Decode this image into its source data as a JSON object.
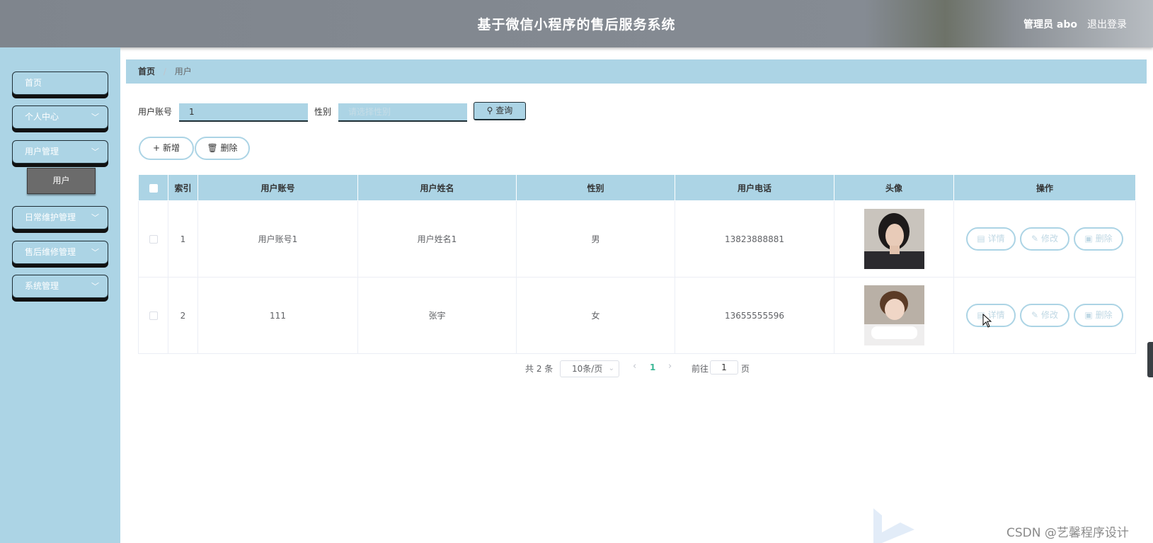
{
  "header": {
    "title": "基于微信小程序的售后服务系统",
    "user": "管理员 abo",
    "logout": "退出登录"
  },
  "sidebar": {
    "items": [
      {
        "label": "首页",
        "has_children": false
      },
      {
        "label": "个人中心",
        "has_children": true
      },
      {
        "label": "用户管理",
        "has_children": true
      },
      {
        "label": "日常维护管理",
        "has_children": true
      },
      {
        "label": "售后维修管理",
        "has_children": true
      },
      {
        "label": "系统管理",
        "has_children": true
      }
    ],
    "submenu_item": "用户"
  },
  "breadcrumb": {
    "home": "首页",
    "separator": "/",
    "current": "用户"
  },
  "search": {
    "account_label": "用户账号",
    "account_value": "1",
    "gender_label": "性别",
    "gender_placeholder": "请选择性别",
    "query_button": "查询"
  },
  "actions": {
    "add": "新增",
    "delete": "删除"
  },
  "table": {
    "columns": [
      "索引",
      "用户账号",
      "用户姓名",
      "性别",
      "用户电话",
      "头像",
      "操作"
    ],
    "rows": [
      {
        "index": "1",
        "account": "用户账号1",
        "name": "用户姓名1",
        "gender": "男",
        "phone": "13823888881"
      },
      {
        "index": "2",
        "account": "111",
        "name": "张宇",
        "gender": "女",
        "phone": "13655555596"
      }
    ],
    "row_actions": {
      "detail": "详情",
      "edit": "修改",
      "delete": "删除"
    }
  },
  "pagination": {
    "total": "共 2 条",
    "page_size": "10条/页",
    "current_page": "1",
    "goto_label": "前往",
    "goto_value": "1",
    "page_suffix": "页"
  },
  "watermark": "CSDN @艺馨程序设计",
  "colors": {
    "accent": "#acd4e5",
    "header_bg": "#858b93",
    "active_page": "#3ab795",
    "submenu_active": "#6b6b6b"
  }
}
